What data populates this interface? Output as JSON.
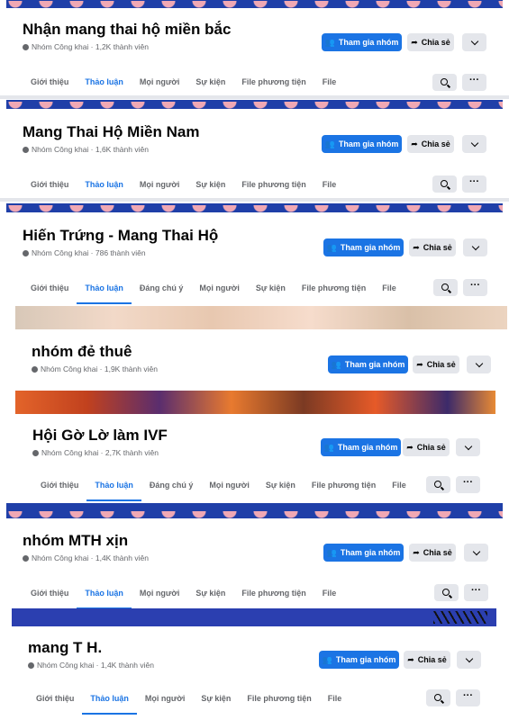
{
  "common": {
    "join_label": "Tham gia nhóm",
    "share_label": "Chia sẻ",
    "join_icon": "people-icon",
    "share_icon": "share-arrow-icon"
  },
  "groups": [
    {
      "title": "Nhận mang thai hộ miền bắc",
      "meta": "Nhóm Công khai · 1,2K thành viên",
      "tabs": [
        "Giới thiệu",
        "Thảo luận",
        "Mọi người",
        "Sự kiện",
        "File phương tiện",
        "File"
      ],
      "active_tab": 1
    },
    {
      "title": "Mang Thai Hộ Miền Nam",
      "meta": "Nhóm Công khai · 1,6K thành viên",
      "tabs": [
        "Giới thiệu",
        "Thảo luận",
        "Mọi người",
        "Sự kiện",
        "File phương tiện",
        "File"
      ],
      "active_tab": 1
    },
    {
      "title": "Hiến Trứng - Mang Thai Hộ",
      "meta": "Nhóm Công khai · 786 thành viên",
      "tabs": [
        "Giới thiệu",
        "Thảo luận",
        "Đáng chú ý",
        "Mọi người",
        "Sự kiện",
        "File phương tiện",
        "File"
      ],
      "active_tab": 1
    },
    {
      "title": "nhóm đẻ thuê",
      "meta": "Nhóm Công khai · 1,9K thành viên",
      "tabs": []
    },
    {
      "title": "Hội Gờ Lờ làm IVF",
      "meta": "Nhóm Công khai · 2,7K thành viên",
      "tabs": [
        "Giới thiệu",
        "Thảo luận",
        "Đáng chú ý",
        "Mọi người",
        "Sự kiện",
        "File phương tiện",
        "File"
      ],
      "active_tab": 1
    },
    {
      "title": "nhóm MTH xịn",
      "meta": "Nhóm Công khai · 1,4K thành viên",
      "tabs": [
        "Giới thiệu",
        "Thảo luận",
        "Mọi người",
        "Sự kiện",
        "File phương tiện",
        "File"
      ],
      "active_tab": 1
    },
    {
      "title": "mang T H.",
      "meta": "Nhóm Công khai · 1,4K thành viên",
      "tabs": [
        "Giới thiệu",
        "Thảo luận",
        "Mọi người",
        "Sự kiện",
        "File phương tiện",
        "File"
      ],
      "active_tab": 1
    }
  ]
}
